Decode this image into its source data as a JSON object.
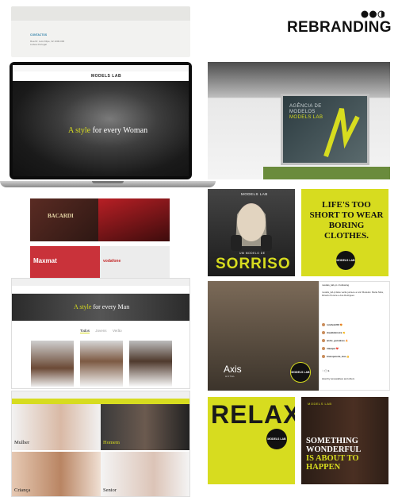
{
  "header": {
    "title": "REBRANDING"
  },
  "laptop": {
    "logo": "MODELS LAB",
    "hero_accent": "A style",
    "hero_rest": " for every Woman"
  },
  "ads": {
    "bacardi": "BACARDI",
    "maxmat": "Maxmat",
    "vodafone": "vodafone"
  },
  "man_page": {
    "hero_accent": "A style",
    "hero_rest": " for every Man",
    "tabs": [
      "Todos",
      "Jovens",
      "Verão"
    ]
  },
  "woman_page": {
    "categories": [
      "Mulher",
      "Homem",
      "Criança",
      "Senior"
    ]
  },
  "building": {
    "sign": [
      "AGÊNCIA DE",
      "MODELOS",
      "MODELS LAB"
    ]
  },
  "sorriso": {
    "logo": "MODELS LAB",
    "subtitle": "UM MODELO DE",
    "word": "SORRISO"
  },
  "life": {
    "text": "LIFE'S TOO SHORT TO WEAR BORING CLOTHES.",
    "seal": "MODELS LAB"
  },
  "axis": {
    "brand": "Axis",
    "sub": "HOTEL",
    "seal": "MODELS LAB"
  },
  "instagram": {
    "handle": "models_lab.pt • Following",
    "caption": "models_lab.pt Este verão junta-te a nós! Modelos: Marta Silva, Ricardo Pereira e Ana Rodrigues",
    "comments": [
      {
        "user": "ruisilva1203",
        "text": "😍"
      },
      {
        "user": "claudiaferreira",
        "text": "👏"
      },
      {
        "user": "andre_goncalves",
        "text": "🔥"
      },
      {
        "user": "ritaaqua",
        "text": "❤️"
      },
      {
        "user": "brunopereira_mao",
        "text": "👍"
      }
    ],
    "likes": "Liked by teresadalves and others"
  },
  "relax": {
    "word": "RELAX",
    "seal": "MODELS LAB"
  },
  "wonder": {
    "logo": "MODELS LAB",
    "line1": "SOMETHING",
    "line2": "WONDERFUL",
    "line3": "IS ABOUT TO",
    "line4": "HAPPEN"
  },
  "contact": {
    "title": "CONTACTOS",
    "address": "Rua Dr. Luís Filipe, 32 1000-000 Lisboa Portugal"
  }
}
